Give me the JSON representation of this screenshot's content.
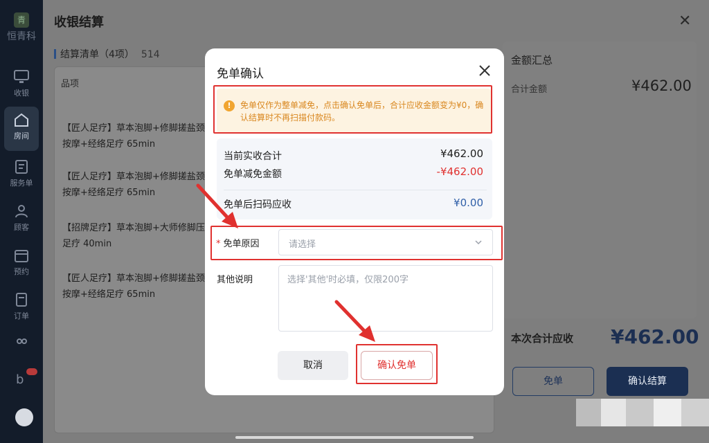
{
  "sidebar": {
    "logo_text": "恒青科",
    "items": [
      {
        "label": "收银",
        "icon": "monitor-icon"
      },
      {
        "label": "房间",
        "icon": "home-icon"
      },
      {
        "label": "服务单",
        "icon": "service-order-icon"
      },
      {
        "label": "顾客",
        "icon": "user-icon"
      },
      {
        "label": "预约",
        "icon": "calendar-icon"
      },
      {
        "label": "订单",
        "icon": "order-icon"
      },
      {
        "label": "",
        "icon": "users-icon"
      },
      {
        "label": "",
        "icon": "brand-icon"
      }
    ]
  },
  "checkout": {
    "title": "收银结算",
    "list_title": "结算清单（4项）",
    "list_count": "514",
    "column_item": "品项",
    "services": [
      "【匠人足疗】草本泡脚+修脚搓盐颈按摩+经络足疗 65min",
      "【匠人足疗】草本泡脚+修脚搓盐颈按摩+经络足疗 65min",
      "【招牌足疗】草本泡脚+大师修脚压足疗 40min",
      "【匠人足疗】草本泡脚+修脚搓盐颈按摩+经络足疗 65min"
    ],
    "summary_title": "金额汇总",
    "total_label": "合计金额",
    "total_value": "¥462.00",
    "due_label": "本次合计应收",
    "due_value": "¥462.00",
    "free_button": "免单",
    "settle_button": "确认结算"
  },
  "modal": {
    "title": "免单确认",
    "notice": "免单仅作为整单减免，点击确认免单后，合计应收金额变为¥0，确认结算时不再扫描付款码。",
    "rows": [
      {
        "label": "当前实收合计",
        "value": "¥462.00"
      },
      {
        "label": "免单减免金额",
        "value": "-¥462.00"
      },
      {
        "label": "免单后扫码应收",
        "value": "¥0.00"
      }
    ],
    "reason_required_mark": "*",
    "reason_label": "免单原因",
    "reason_placeholder": "请选择",
    "other_label": "其他说明",
    "other_placeholder": "选择'其他'时必填，仅限200字",
    "cancel_button": "取消",
    "confirm_button": "确认免单"
  },
  "colors": {
    "highlight_red": "#e0312f",
    "notice_orange": "#d9871f",
    "negative_red": "#e0312f",
    "zero_blue": "#2f5fa8",
    "primary_navy": "#1b2f52"
  }
}
